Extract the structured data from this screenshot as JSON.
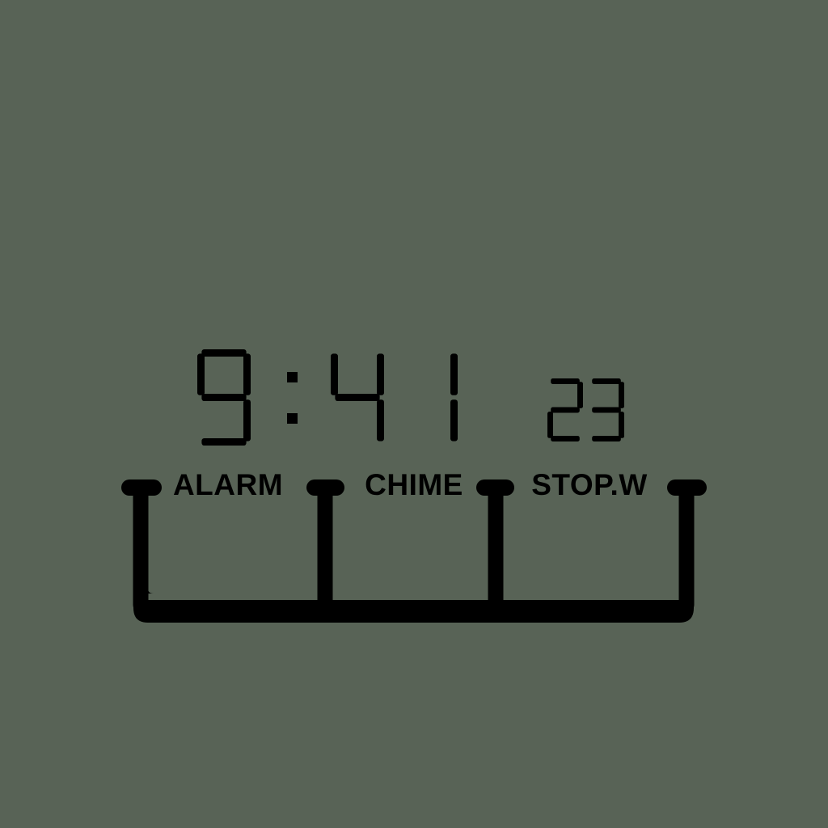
{
  "colors": {
    "lcd_background": "#586356",
    "segment_on": "#000000"
  },
  "clock": {
    "hours": "9",
    "minutes": "41",
    "seconds": "23",
    "colon": ":"
  },
  "modes": [
    {
      "label": "ALARM"
    },
    {
      "label": "CHIME"
    },
    {
      "label": "STOP.W"
    }
  ]
}
